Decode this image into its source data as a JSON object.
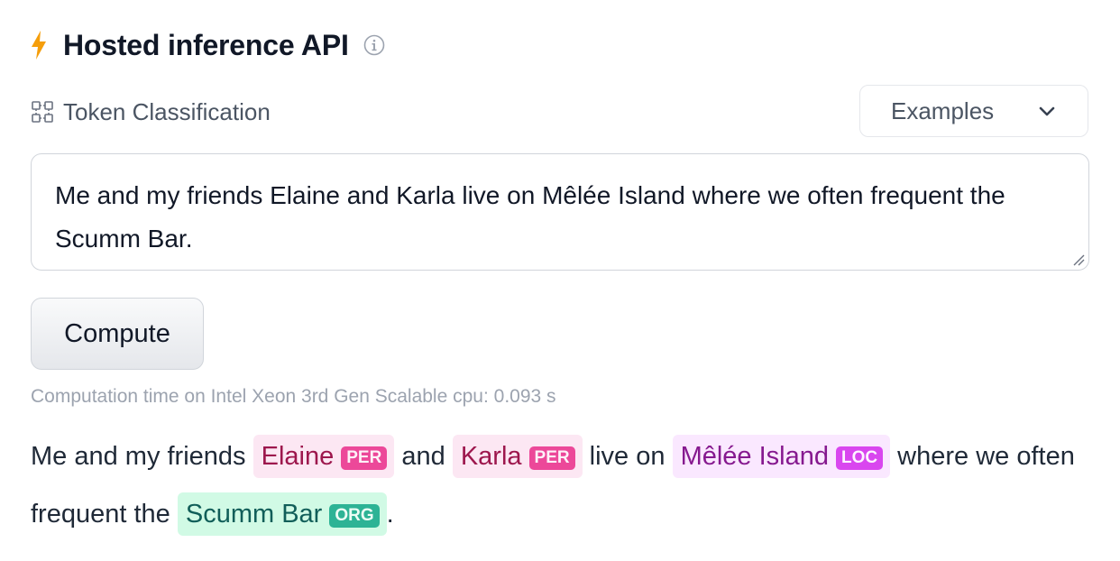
{
  "header": {
    "title": "Hosted inference API",
    "icon": "lightning-bolt-icon",
    "accent_color": "#f59e0b",
    "info_icon": "info-circle-icon"
  },
  "task": {
    "icon": "token-classification-icon",
    "label": "Token Classification"
  },
  "examples": {
    "label": "Examples",
    "icon": "chevron-down-icon"
  },
  "input": {
    "value": "Me and my friends Elaine and Karla live on Mêlée Island where we often frequent the Scumm Bar."
  },
  "compute": {
    "label": "Compute"
  },
  "timing": {
    "text": "Computation time on Intel Xeon 3rd Gen Scalable cpu: 0.093 s"
  },
  "output": {
    "seg_0": "Me and my friends",
    "ent_0": {
      "text": "Elaine",
      "label": "PER",
      "color": "#ec4899"
    },
    "seg_1": "and",
    "ent_1": {
      "text": "Karla",
      "label": "PER",
      "color": "#ec4899"
    },
    "seg_2": "live on",
    "ent_2": {
      "text": "Mêlée Island",
      "label": "LOC",
      "color": "#d946ef"
    },
    "seg_3": "where we often frequent the",
    "ent_3": {
      "text": "Scumm Bar",
      "label": "ORG",
      "color": "#2db395"
    },
    "seg_4": "."
  }
}
